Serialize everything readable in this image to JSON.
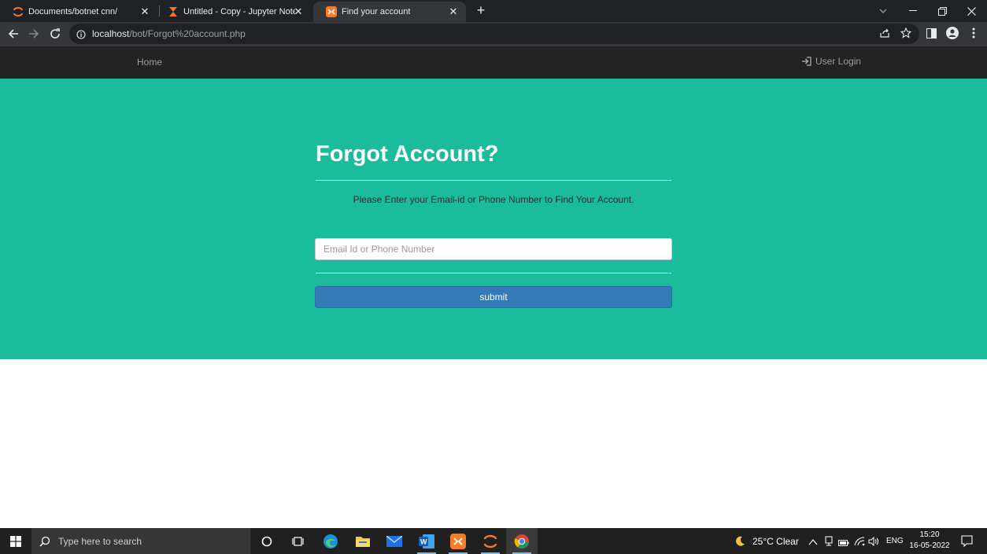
{
  "browser": {
    "tabs": [
      {
        "title": "Documents/botnet cnn/",
        "favicon": "jupyter-icon"
      },
      {
        "title": "Untitled - Copy - Jupyter Notebook",
        "favicon": "hourglass-icon"
      },
      {
        "title": "Find your account",
        "favicon": "xampp-icon",
        "active": true
      }
    ],
    "address": {
      "host": "localhost",
      "path": "/bot/Forgot%20account.php"
    }
  },
  "site_nav": {
    "home_label": "Home",
    "login_label": "User Login"
  },
  "hero": {
    "heading": "Forgot Account?",
    "subtext": "Please Enter your Email-id or Phone Number to Find Your Account.",
    "input_placeholder": "Email Id or Phone Number",
    "submit_label": "submit"
  },
  "taskbar": {
    "search_placeholder": "Type here to search",
    "weather": "25°C  Clear",
    "language": "ENG",
    "time": "15:20",
    "date": "16-05-2022"
  },
  "colors": {
    "hero_bg": "#1abc9c",
    "nav_bg": "#222222",
    "button_bg": "#337ab7"
  }
}
